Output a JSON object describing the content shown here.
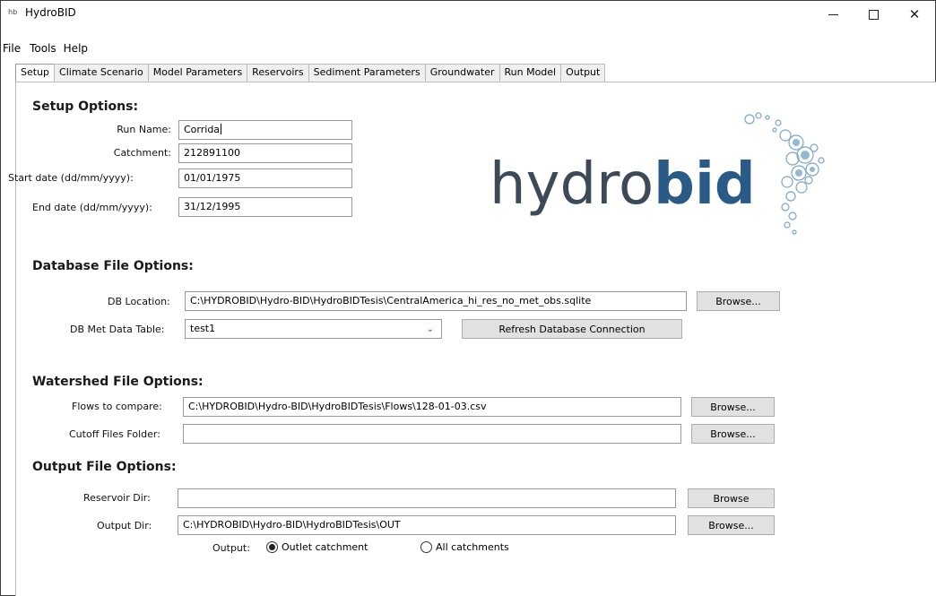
{
  "window": {
    "icon_text": "hb",
    "title": "HydroBID"
  },
  "menu": {
    "file": "File",
    "tools": "Tools",
    "help": "Help"
  },
  "tabs": [
    "Setup",
    "Climate Scenario",
    "Model Parameters",
    "Reservoirs",
    "Sediment Parameters",
    "Groundwater",
    "Run Model",
    "Output"
  ],
  "setup": {
    "title": "Setup Options:",
    "run_name_label": "Run Name:",
    "run_name_value": "Corrida",
    "catchment_label": "Catchment:",
    "catchment_value": "212891100",
    "start_label": "Start date (dd/mm/yyyy):",
    "start_value": "01/01/1975",
    "end_label": "End date (dd/mm/yyyy):",
    "end_value": "31/12/1995"
  },
  "logo": {
    "thin": "hydro",
    "bold": "bid"
  },
  "database": {
    "title": "Database File Options:",
    "location_label": "DB Location:",
    "location_value": "C:\\HYDROBID\\Hydro-BID\\HydroBIDTesis\\CentralAmerica_hi_res_no_met_obs.sqlite",
    "browse_label": "Browse...",
    "met_label": "DB Met Data Table:",
    "met_value": "test1",
    "refresh_label": "Refresh Database Connection"
  },
  "watershed": {
    "title": "Watershed File Options:",
    "flows_label": "Flows to compare:",
    "flows_value": "C:\\HYDROBID\\Hydro-BID\\HydroBIDTesis\\Flows\\128-01-03.csv",
    "flows_browse": "Browse...",
    "cutoff_label": "Cutoff Files Folder:",
    "cutoff_value": "",
    "cutoff_browse": "Browse..."
  },
  "output": {
    "title": "Output File Options:",
    "reservoir_label": "Reservoir Dir:",
    "reservoir_value": "",
    "reservoir_browse": "Browse",
    "outdir_label": "Output Dir:",
    "outdir_value": "C:\\HYDROBID\\Hydro-BID\\HydroBIDTesis\\OUT",
    "outdir_browse": "Browse...",
    "output_label": "Output:",
    "radio_outlet": "Outlet catchment",
    "radio_all": "All catchments",
    "selected": "Outlet catchment"
  }
}
